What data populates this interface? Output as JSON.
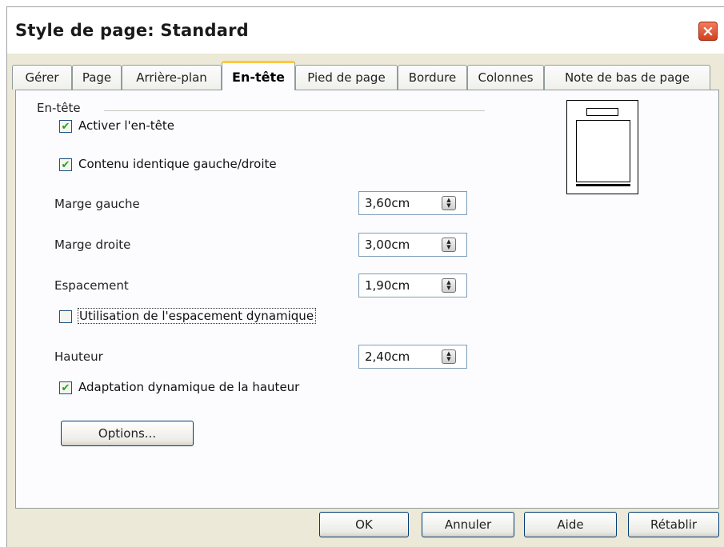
{
  "window": {
    "title": "Style de page: Standard",
    "close_icon": "×"
  },
  "tabs": [
    {
      "label": "Gérer"
    },
    {
      "label": "Page"
    },
    {
      "label": "Arrière-plan"
    },
    {
      "label": "En-tête",
      "active": true
    },
    {
      "label": "Pied de page"
    },
    {
      "label": "Bordure"
    },
    {
      "label": "Colonnes"
    },
    {
      "label": "Note de bas de page"
    }
  ],
  "section": {
    "label": "En-tête"
  },
  "options": {
    "activate_header": {
      "label": "Activer l'en-tête",
      "checked": true
    },
    "same_content": {
      "label": "Contenu identique gauche/droite",
      "checked": true
    },
    "dynamic_spacing": {
      "label": "Utilisation de l'espacement dynamique",
      "checked": false
    },
    "autofit_height": {
      "label": "Adaptation dynamique de la hauteur",
      "checked": true
    }
  },
  "fields": {
    "left_margin": {
      "label": "Marge gauche",
      "value": "3,60cm"
    },
    "right_margin": {
      "label": "Marge droite",
      "value": "3,00cm"
    },
    "spacing": {
      "label": "Espacement",
      "value": "1,90cm"
    },
    "height": {
      "label": "Hauteur",
      "value": "2,40cm"
    }
  },
  "buttons": {
    "more_options": "Options...",
    "ok": "OK",
    "cancel": "Annuler",
    "help": "Aide",
    "reset": "Rétablir"
  },
  "check_glyph": "✔",
  "colors": {
    "dialog_bg": "#ece9d8",
    "panel_bg": "#fcfcfe",
    "active_tab_accent": "#ffc83c",
    "checkmark": "#21a121",
    "close_button": "#d1401e"
  }
}
